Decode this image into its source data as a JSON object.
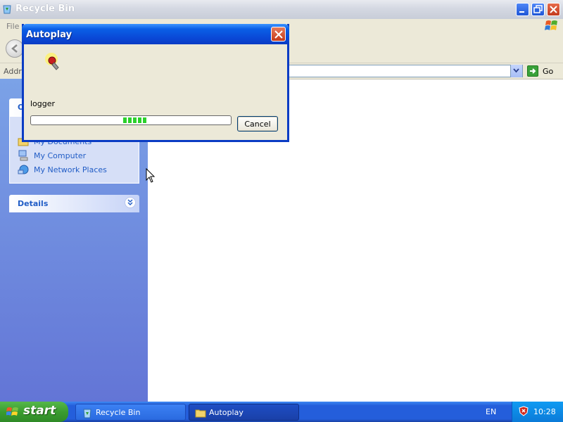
{
  "window": {
    "title": "Recycle Bin",
    "menu": [
      "File"
    ],
    "address_label": "Addre",
    "go_label": "Go"
  },
  "taskpane": {
    "other_places_header_visible": "O",
    "places": [
      {
        "label": "My Documents",
        "icon": "folder-icon"
      },
      {
        "label": "My Computer",
        "icon": "computer-icon"
      },
      {
        "label": "My Network Places",
        "icon": "network-places-icon"
      }
    ],
    "details_header": "Details"
  },
  "dialog": {
    "title": "Autoplay",
    "text": "logger",
    "cancel_label": "Cancel",
    "progress_blocks": 5
  },
  "taskbar": {
    "start_label": "start",
    "tasks": [
      {
        "label": "Recycle Bin",
        "icon": "recycle-bin-icon",
        "active": false
      },
      {
        "label": "Autoplay",
        "icon": "folder-icon",
        "active": true
      }
    ],
    "language": "EN",
    "clock": "10:28"
  },
  "colors": {
    "taskpane_top": "#7ba2e7",
    "taskpane_bottom": "#6375d6",
    "dialog_titlebar": "#0a48d6",
    "taskbar": "#245edb",
    "start_button": "#3a9c30",
    "progress_block": "#2cd02c"
  }
}
